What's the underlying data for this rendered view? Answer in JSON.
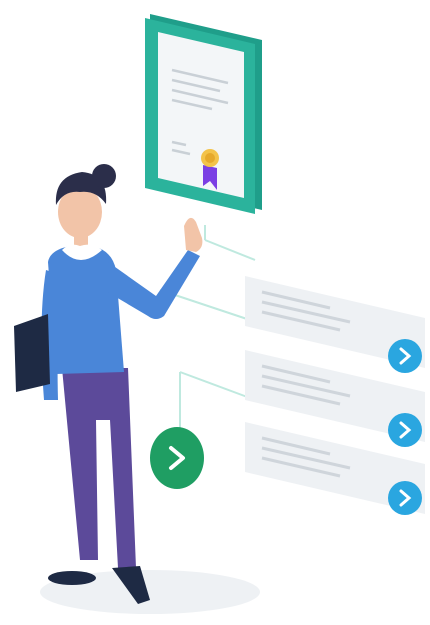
{
  "illustration": {
    "colors": {
      "tablet_frame": "#1f9e8a",
      "tablet_screen": "#f3f6f8",
      "text_lines": "#c9d0d6",
      "ribbon": "#7b3fe4",
      "medal": "#f3c34a",
      "card_bg": "#eef1f4",
      "card_lines": "#cfd5db",
      "blue_button": "#2aa6e0",
      "green_button": "#1f9e63",
      "shirt": "#4a86d8",
      "pants": "#5c4a9a",
      "hair": "#2b2e4a",
      "skin": "#f2c4a8",
      "folder": "#1e2a44",
      "shadow": "#eef1f4",
      "connector": "#bfe9df"
    },
    "icons": {
      "card_arrow": "chevron-right-icon",
      "floating_arrow": "chevron-right-icon",
      "certificate": "award-ribbon-icon"
    }
  }
}
